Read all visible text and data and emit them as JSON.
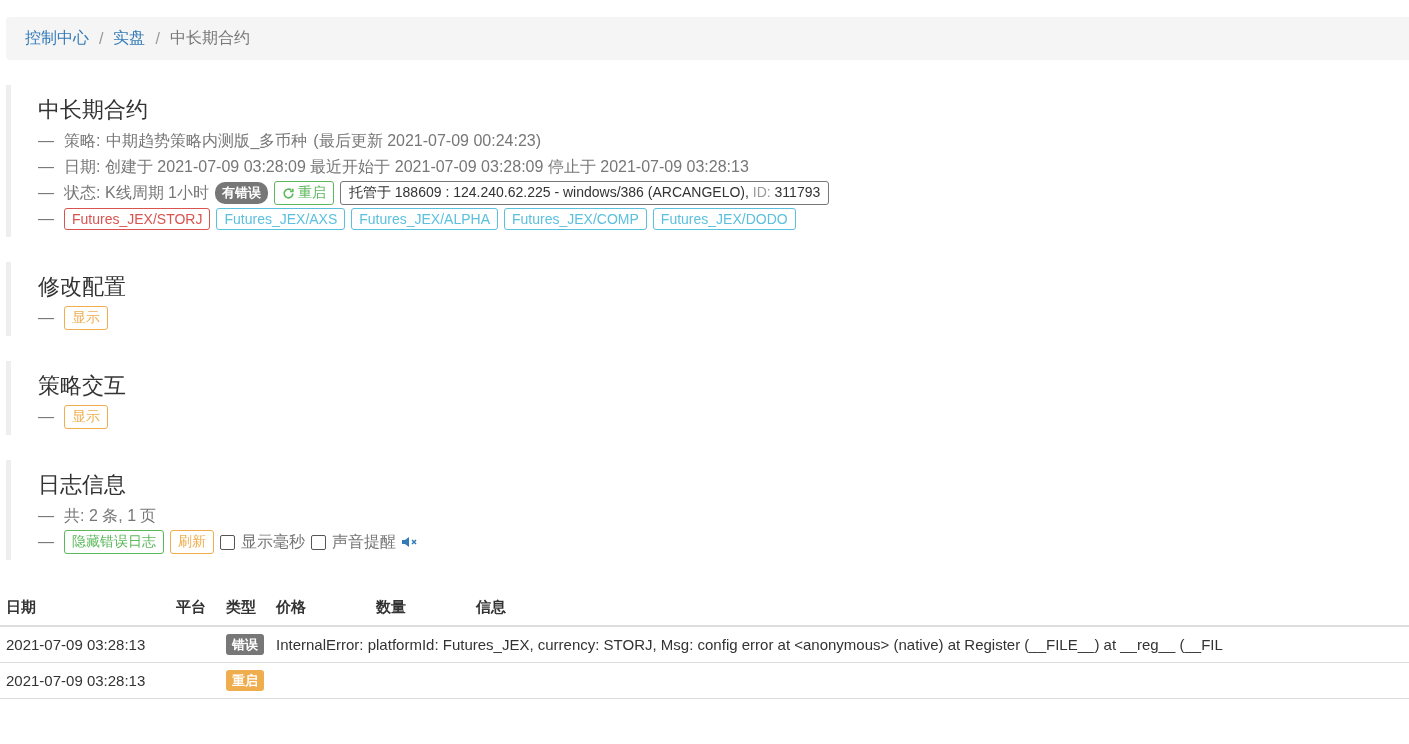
{
  "breadcrumb_separator": "/",
  "breadcrumb": [
    {
      "label": "控制中心",
      "kind": "link"
    },
    {
      "label": "实盘",
      "kind": "link"
    },
    {
      "label": "中长期合约",
      "kind": "current"
    }
  ],
  "robot": {
    "title": "中长期合约",
    "dash": "—",
    "strategy": {
      "label": "策略:",
      "name": "中期趋势策略内测版_多币种",
      "updated": "(最后更新 2021-07-09 00:24:23)"
    },
    "date": "日期: 创建于 2021-07-09 03:28:09 最近开始于 2021-07-09 03:28:09 停止于 2021-07-09 03:28:13",
    "status": {
      "label": "状态: K线周期 1小时",
      "badge": "有错误",
      "restart": "重启",
      "host": "托管于 188609 : 124.240.62.225 - windows/386 (ARCANGELO),",
      "id_label": "ID:",
      "id": "311793"
    },
    "pairs": [
      {
        "label": "Futures_JEX/STORJ",
        "color": "#d9534f"
      },
      {
        "label": "Futures_JEX/AXS",
        "color": "#5bc0de"
      },
      {
        "label": "Futures_JEX/ALPHA",
        "color": "#5bc0de"
      },
      {
        "label": "Futures_JEX/COMP",
        "color": "#5bc0de"
      },
      {
        "label": "Futures_JEX/DODO",
        "color": "#5bc0de"
      }
    ]
  },
  "config": {
    "title": "修改配置",
    "dash": "—",
    "button": "显示"
  },
  "interaction": {
    "title": "策略交互",
    "dash": "—",
    "button": "显示"
  },
  "logs": {
    "title": "日志信息",
    "dash": "—",
    "summary": "共: 2 条, 1 页",
    "hide_errors": "隐藏错误日志",
    "refresh": "刷新",
    "options": [
      {
        "label": "显示毫秒",
        "checked": false
      },
      {
        "label": "声音提醒",
        "checked": false
      }
    ],
    "columns": [
      "日期",
      "平台",
      "类型",
      "价格",
      "数量",
      "信息"
    ],
    "rows": [
      {
        "date": "2021-07-09 03:28:13",
        "type": "错误",
        "kind": "error",
        "message": "InternalError: platformId: Futures_JEX, currency: STORJ, Msg: config error at <anonymous> (native) at Register (__FILE__) at __reg__ (__FIL"
      },
      {
        "date": "2021-07-09 03:28:13",
        "type": "重启",
        "kind": "restart"
      }
    ]
  }
}
